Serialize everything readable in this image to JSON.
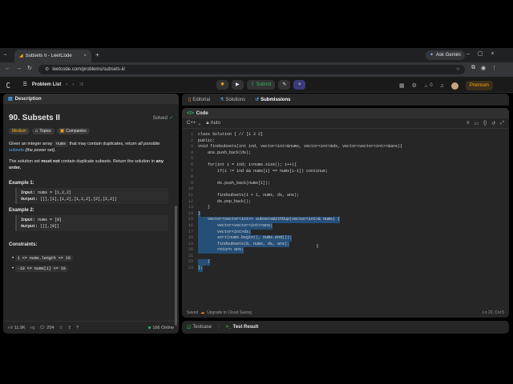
{
  "browser": {
    "tab_title": "Subsets II - LeetCode",
    "url": "leetcode.com/problems/subsets-ii/",
    "ask_gemini": "Ask Gemini"
  },
  "lc_nav": {
    "problem_list": "Problem List",
    "submit": "Submit",
    "streak": "0",
    "premium": "Premium"
  },
  "left": {
    "tab_description": "Description",
    "title": "90. Subsets II",
    "solved": "Solved",
    "tag_medium": "Medium",
    "tag_topics": "Topics",
    "tag_companies": "Companies",
    "desc1_a": "Given an integer array ",
    "desc1_code": "nums",
    "desc1_b": " that may contain duplicates, return ",
    "desc1_all": "all possible",
    "desc1_subsets": "subsets",
    "desc1_c": " (the power set).",
    "desc2_a": "The solution set ",
    "desc2_must": "must not",
    "desc2_b": " contain duplicate subsets. Return the solution in ",
    "desc2_any": "any order.",
    "ex1_title": "Example 1:",
    "ex1_input_label": "Input:",
    "ex1_input": "nums = [1,2,2]",
    "ex1_output_label": "Output:",
    "ex1_output": "[[],[1],[1,2],[1,2,2],[2],[2,2]]",
    "ex2_title": "Example 2:",
    "ex2_input_label": "Input:",
    "ex2_input": "nums = [0]",
    "ex2_output_label": "Output:",
    "ex2_output": "[[],[0]]",
    "constraints_title": "Constraints:",
    "constraint1": "1 <= nums.length <= 10",
    "constraint2": "-10 <= nums[i] <= 10",
    "likes": "11.9K",
    "comments": "204",
    "online": "166 Online"
  },
  "right_tabs": {
    "editorial": "Editorial",
    "solutions": "Solutions",
    "submissions": "Submissions"
  },
  "code": {
    "header": "Code",
    "language": "C++",
    "auto": "Auto",
    "saved": "Saved",
    "upgrade": "Upgrade to Cloud Saving",
    "cursor": "Ln 22, Col 5",
    "lines": [
      {
        "n": "1",
        "t": "class Solution { // [1 2 2]",
        "sel": false
      },
      {
        "n": "2",
        "t": "public:",
        "sel": false
      },
      {
        "n": "3",
        "t": "void findsubsets(int ind, vector<int>&nums, vector<int>&ds, vector<vector<int>>&ans){",
        "sel": false
      },
      {
        "n": "4",
        "t": "    ans.push_back(ds);",
        "sel": false
      },
      {
        "n": "5",
        "t": "",
        "sel": false
      },
      {
        "n": "6",
        "t": "    for(int i = ind; i<nums.size(); i++){",
        "sel": false
      },
      {
        "n": "7",
        "t": "        if(i != ind && nums[i] == nums[i-1]) continue;",
        "sel": false
      },
      {
        "n": "8",
        "t": "",
        "sel": false
      },
      {
        "n": "9",
        "t": "        ds.push_back(nums[i]);",
        "sel": false
      },
      {
        "n": "10",
        "t": "",
        "sel": false
      },
      {
        "n": "11",
        "t": "        findsubsets(i + 1, nums, ds, ans);",
        "sel": false
      },
      {
        "n": "12",
        "t": "        ds.pop_back();",
        "sel": false
      },
      {
        "n": "13",
        "t": "    }",
        "sel": false
      },
      {
        "n": "14",
        "t": "}",
        "sel": true
      },
      {
        "n": "15",
        "t": "    vector<vector<int>> subsetsWithDup(vector<int>& nums) {",
        "sel": true
      },
      {
        "n": "16",
        "t": "        vector<vector<int>>ans;",
        "sel": true
      },
      {
        "n": "17",
        "t": "        vector<int>ds;",
        "sel": true
      },
      {
        "n": "18",
        "t": "        sort(nums.begin(), nums.end());",
        "sel": true
      },
      {
        "n": "19",
        "t": "        findsubsets(0, nums, ds, ans);",
        "sel": true
      },
      {
        "n": "20",
        "t": "        return ans;",
        "sel": true
      },
      {
        "n": "21",
        "t": "",
        "sel": true
      },
      {
        "n": "22",
        "t": "    }",
        "sel": true
      },
      {
        "n": "23",
        "t": "};",
        "sel": true
      }
    ]
  },
  "bottom": {
    "testcase": "Testcase",
    "test_result": "Test Result"
  },
  "colors": {
    "accent_green": "#2cbb5d",
    "premium": "#ffa116",
    "selection": "#264f78"
  }
}
